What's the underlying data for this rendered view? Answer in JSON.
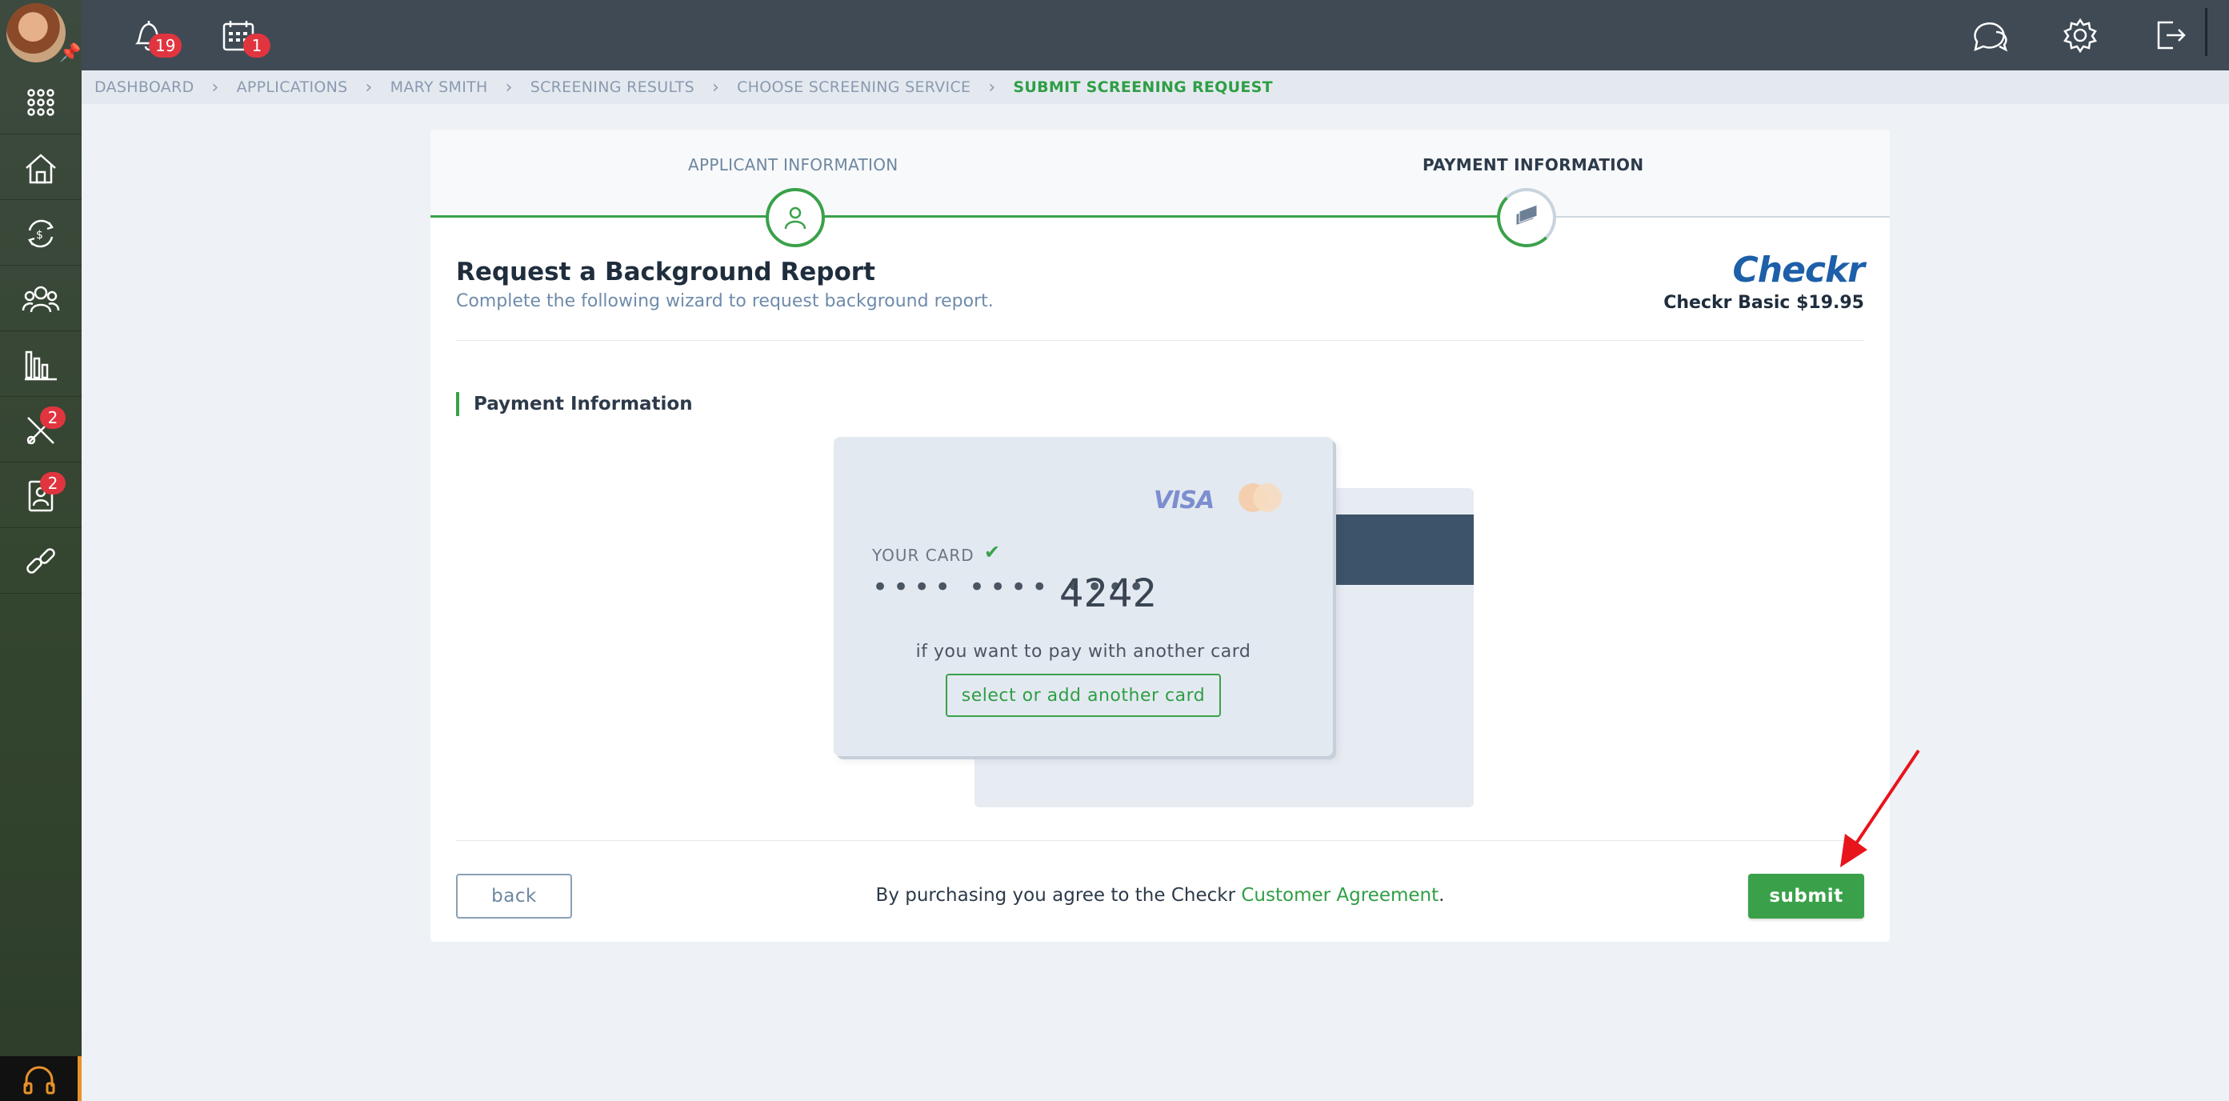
{
  "topbar": {
    "notifications_count": "19",
    "calendar_count": "1"
  },
  "sidebar": {
    "items": [
      {
        "icon": "apps-grid-icon"
      },
      {
        "icon": "properties-icon"
      },
      {
        "icon": "accounting-icon"
      },
      {
        "icon": "people-icon"
      },
      {
        "icon": "reports-icon"
      },
      {
        "icon": "maintenance-icon",
        "badge": "2"
      },
      {
        "icon": "applicants-icon",
        "badge": "2"
      },
      {
        "icon": "links-icon"
      }
    ]
  },
  "breadcrumb": {
    "items": [
      "DASHBOARD",
      "APPLICATIONS",
      "MARY SMITH",
      "SCREENING RESULTS",
      "CHOOSE SCREENING SERVICE"
    ],
    "active": "SUBMIT SCREENING REQUEST"
  },
  "wizard": {
    "step1": "APPLICANT INFORMATION",
    "step2": "PAYMENT INFORMATION"
  },
  "header": {
    "title": "Request a Background Report",
    "subtitle": "Complete the following wizard to request background report.",
    "brand": "Checkr",
    "plan": "Checkr Basic $19.95"
  },
  "payment": {
    "section_title": "Payment Information",
    "card_brand": "VISA",
    "your_card_label": "YOUR CARD",
    "masked": "•••• •••• ••••",
    "last4": "4242",
    "another_text": "if you want to pay with another card",
    "another_button": "select or add another card"
  },
  "footer": {
    "back_label": "back",
    "agree_prefix": "By purchasing you agree to the Checkr ",
    "agree_link": "Customer Agreement",
    "agree_suffix": ".",
    "submit_label": "submit"
  },
  "colors": {
    "accent": "#3aa14a",
    "topbar": "#3f4a55",
    "brand": "#1d5fa8",
    "badge": "#e0353f"
  }
}
